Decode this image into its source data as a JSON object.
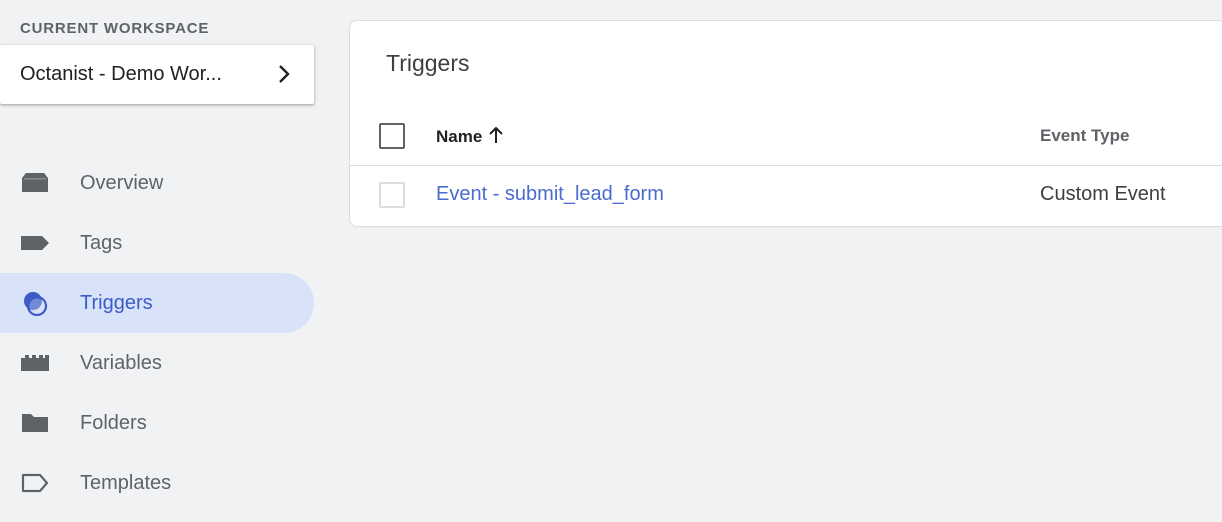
{
  "sidebar": {
    "workspace_label": "CURRENT WORKSPACE",
    "workspace_name": "Octanist - Demo Wor...",
    "items": [
      {
        "label": "Overview",
        "icon": "overview-icon"
      },
      {
        "label": "Tags",
        "icon": "tag-icon"
      },
      {
        "label": "Triggers",
        "icon": "trigger-icon",
        "active": true
      },
      {
        "label": "Variables",
        "icon": "variables-icon"
      },
      {
        "label": "Folders",
        "icon": "folder-icon"
      },
      {
        "label": "Templates",
        "icon": "template-icon"
      }
    ]
  },
  "main": {
    "title": "Triggers",
    "columns": {
      "name": "Name",
      "event_type": "Event Type"
    },
    "rows": [
      {
        "name": "Event - submit_lead_form",
        "event_type": "Custom Event"
      }
    ]
  },
  "colors": {
    "accent": "#3b5cc5",
    "active_bg": "#d8e2f9",
    "link": "#4a6bd1",
    "icon": "#5f6368",
    "page_bg": "#f1f2f4"
  }
}
